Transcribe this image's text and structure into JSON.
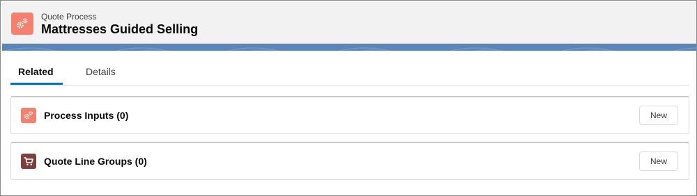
{
  "header": {
    "eyebrow": "Quote Process",
    "title": "Mattresses Guided Selling",
    "icon": "gears-icon",
    "icon_color": "#f4806f",
    "band_color": "#5b86b8"
  },
  "tabs": [
    {
      "label": "Related",
      "active": true
    },
    {
      "label": "Details",
      "active": false
    }
  ],
  "accent_color": "#0070d2",
  "cards": [
    {
      "title": "Process Inputs (0)",
      "icon": "gears-icon",
      "icon_color": "#f4806f",
      "button_label": "New"
    },
    {
      "title": "Quote Line Groups (0)",
      "icon": "cart-icon",
      "icon_color": "#7f3f3f",
      "button_label": "New"
    }
  ]
}
